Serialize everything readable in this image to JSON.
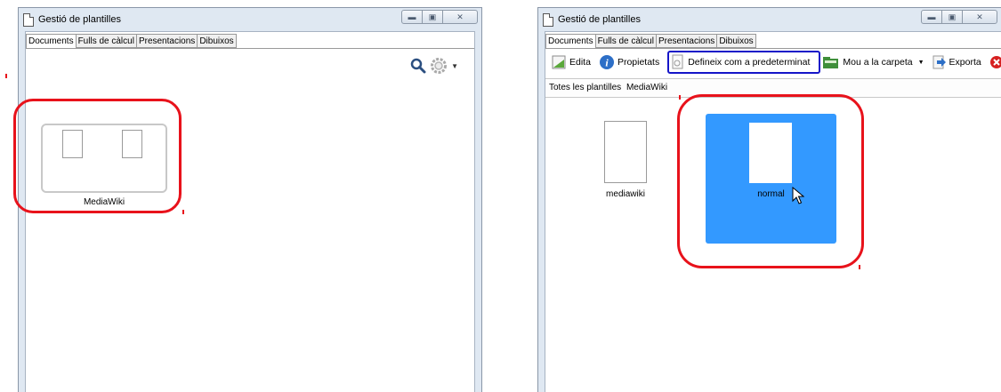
{
  "left_window": {
    "title": "Gestió de plantilles",
    "tabs": [
      "Documents",
      "Fulls de càlcul",
      "Presentacions",
      "Dibuixos"
    ],
    "active_tab": 0,
    "toolbar_icons": [
      "search-icon",
      "gear-icon"
    ],
    "folder": {
      "label": "MediaWiki"
    }
  },
  "right_window": {
    "title": "Gestió de plantilles",
    "tabs": [
      "Documents",
      "Fulls de càlcul",
      "Presentacions",
      "Dibuixos"
    ],
    "active_tab": 0,
    "toolbar": {
      "edit": "Edita",
      "properties": "Propietats",
      "set_default": "Defineix com a predeterminat",
      "move": "Mou a la carpeta",
      "export": "Exporta"
    },
    "breadcrumb": {
      "root": "Totes les plantilles",
      "folder": "MediaWiki"
    },
    "templates": [
      {
        "label": "mediawiki",
        "selected": false
      },
      {
        "label": "normal",
        "selected": true
      }
    ]
  },
  "colors": {
    "highlight_ring": "#e8121b",
    "highlight_box": "#1515c8",
    "selection": "#3399ff"
  }
}
